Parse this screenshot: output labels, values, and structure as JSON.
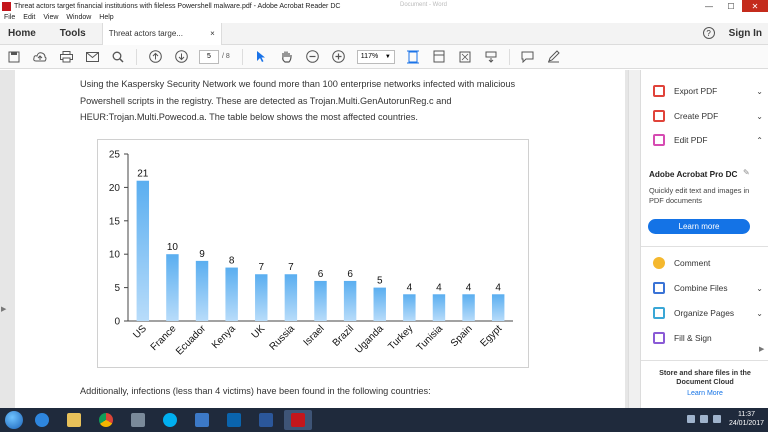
{
  "window": {
    "title": "Threat actors target financial institutions with fileless Powershell malware.pdf - Adobe Acrobat Reader DC",
    "ghost_title": "Document - Word",
    "minimize": "—",
    "maximize": "☐",
    "close": "✕"
  },
  "menu": [
    "File",
    "Edit",
    "View",
    "Window",
    "Help"
  ],
  "tabs": {
    "home": "Home",
    "tools": "Tools",
    "doc_tab": "Threat actors targe...",
    "doc_tab_close": "×",
    "help": "?",
    "sign_in": "Sign In"
  },
  "toolbar": {
    "page_current": "5",
    "page_total": "/ 8",
    "zoom": "117%"
  },
  "document": {
    "paragraph1": "Using the Kaspersky Security Network we found more than 100 enterprise networks infected with malicious Powershell scripts in the registry. These are detected as Trojan.Multi.GenAutorunReg.c and HEUR:Trojan.Multi.Powecod.a. The table below shows the most affected countries.",
    "paragraph2": "Additionally, infections (less than 4 victims) have been found in the following countries:"
  },
  "chart_data": {
    "type": "bar",
    "categories": [
      "US",
      "France",
      "Ecuador",
      "Kenya",
      "UK",
      "Russia",
      "Israel",
      "Brazil",
      "Uganda",
      "Turkey",
      "Tunisia",
      "Spain",
      "Egypt"
    ],
    "values": [
      21,
      10,
      9,
      8,
      7,
      7,
      6,
      6,
      5,
      4,
      4,
      4,
      4
    ],
    "ylim": [
      0,
      25
    ],
    "yticks": [
      0,
      5,
      10,
      15,
      20,
      25
    ],
    "grid": false,
    "legend": "none",
    "bar_color": "#5aaef0",
    "bar_color_light": "#b8dcfa"
  },
  "right_pane": {
    "export_pdf": "Export PDF",
    "create_pdf": "Create PDF",
    "edit_pdf": "Edit PDF",
    "pro_title": "Adobe Acrobat Pro DC",
    "pro_desc": "Quickly edit text and images in PDF documents",
    "learn_more": "Learn more",
    "comment": "Comment",
    "combine_files": "Combine Files",
    "organize_pages": "Organize Pages",
    "fill_sign": "Fill & Sign",
    "store_text": "Store and share files in the Document Cloud",
    "store_link": "Learn More"
  },
  "taskbar": {
    "time": "11:37",
    "date": "24/01/2017"
  },
  "colors": {
    "accent": "#1473e6",
    "export_icon": "#e0433a",
    "create_icon": "#e0433a",
    "edit_icon": "#d64bb2",
    "comment_icon": "#f5b82e",
    "combine_icon": "#3a73d6",
    "organize_icon": "#3aa7d6",
    "fill_icon": "#8a5ad6"
  }
}
